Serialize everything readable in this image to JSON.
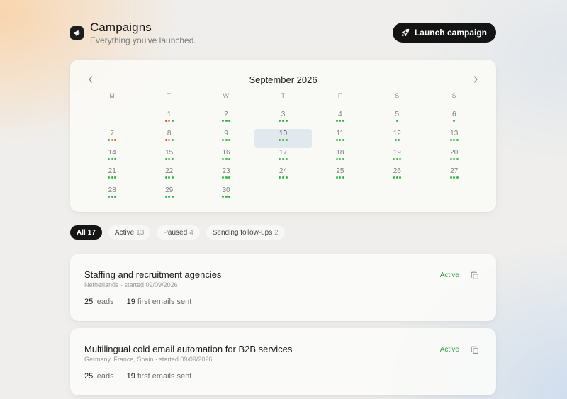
{
  "header": {
    "title": "Campaigns",
    "subtitle": "Everything you've launched.",
    "logo_icon": "megaphone-icon",
    "launch_label": "Launch campaign",
    "launch_icon": "rocket-icon"
  },
  "calendar": {
    "month_label": "September 2026",
    "prev_icon": "chevron-left-icon",
    "next_icon": "chevron-right-icon",
    "weekdays": [
      "M",
      "T",
      "W",
      "T",
      "F",
      "S",
      "S"
    ],
    "start_offset": 1,
    "selected_day": 10,
    "dot_colors": {
      "green": "#3cb54a",
      "orange": "#f08a2c",
      "red": "#e2533a"
    },
    "days": [
      {
        "day": "1",
        "dots": [
          "red",
          "orange",
          "green"
        ]
      },
      {
        "day": "2",
        "dots": [
          "green",
          "green",
          "green"
        ]
      },
      {
        "day": "3",
        "dots": [
          "green",
          "green",
          "green"
        ]
      },
      {
        "day": "4",
        "dots": [
          "green",
          "green",
          "green"
        ]
      },
      {
        "day": "5",
        "dots": [
          "green"
        ]
      },
      {
        "day": "6",
        "dots": [
          "green"
        ]
      },
      {
        "day": "7",
        "dots": [
          "green",
          "orange",
          "red"
        ]
      },
      {
        "day": "8",
        "dots": [
          "red",
          "orange",
          "green"
        ]
      },
      {
        "day": "9",
        "dots": [
          "green",
          "green",
          "green"
        ]
      },
      {
        "day": "10",
        "dots": [
          "green",
          "green",
          "green"
        ]
      },
      {
        "day": "11",
        "dots": [
          "green",
          "green",
          "green"
        ]
      },
      {
        "day": "12",
        "dots": [
          "green",
          "green"
        ]
      },
      {
        "day": "13",
        "dots": [
          "green",
          "green",
          "green"
        ]
      },
      {
        "day": "14",
        "dots": [
          "green",
          "green",
          "green"
        ]
      },
      {
        "day": "15",
        "dots": [
          "green",
          "green",
          "green"
        ]
      },
      {
        "day": "16",
        "dots": [
          "green",
          "green",
          "green"
        ]
      },
      {
        "day": "17",
        "dots": [
          "green",
          "green",
          "green"
        ]
      },
      {
        "day": "18",
        "dots": [
          "green",
          "green",
          "green"
        ]
      },
      {
        "day": "19",
        "dots": [
          "green",
          "green",
          "green"
        ]
      },
      {
        "day": "20",
        "dots": [
          "green",
          "green",
          "green"
        ]
      },
      {
        "day": "21",
        "dots": [
          "green",
          "green",
          "green"
        ]
      },
      {
        "day": "22",
        "dots": [
          "green",
          "green",
          "green"
        ]
      },
      {
        "day": "23",
        "dots": [
          "green",
          "green",
          "green"
        ]
      },
      {
        "day": "24",
        "dots": [
          "green",
          "green",
          "green"
        ]
      },
      {
        "day": "25",
        "dots": [
          "green",
          "green",
          "green"
        ]
      },
      {
        "day": "26",
        "dots": [
          "green",
          "green",
          "green"
        ]
      },
      {
        "day": "27",
        "dots": [
          "green",
          "green",
          "green"
        ]
      },
      {
        "day": "28",
        "dots": [
          "green",
          "green",
          "green"
        ]
      },
      {
        "day": "29",
        "dots": [
          "green",
          "green",
          "green"
        ]
      },
      {
        "day": "30",
        "dots": [
          "green",
          "green",
          "green"
        ]
      }
    ]
  },
  "filters": [
    {
      "label": "All",
      "count": "17",
      "active": true
    },
    {
      "label": "Active",
      "count": "13",
      "active": false
    },
    {
      "label": "Paused",
      "count": "4",
      "active": false
    },
    {
      "label": "Sending follow-ups",
      "count": "2",
      "active": false
    }
  ],
  "campaigns": [
    {
      "title": "Staffing and recruitment agencies",
      "meta": "Netherlands · started 09/09/2026",
      "leads_value": "25",
      "leads_label": "leads",
      "emails_value": "19",
      "emails_label": "first emails sent",
      "status": "Active",
      "copy_icon": "copy-icon"
    },
    {
      "title": "Multilingual cold email automation for B2B services",
      "meta": "Germany, France, Spain · started 09/09/2026",
      "leads_value": "25",
      "leads_label": "leads",
      "emails_value": "19",
      "emails_label": "first emails sent",
      "status": "Active",
      "copy_icon": "copy-icon"
    }
  ]
}
